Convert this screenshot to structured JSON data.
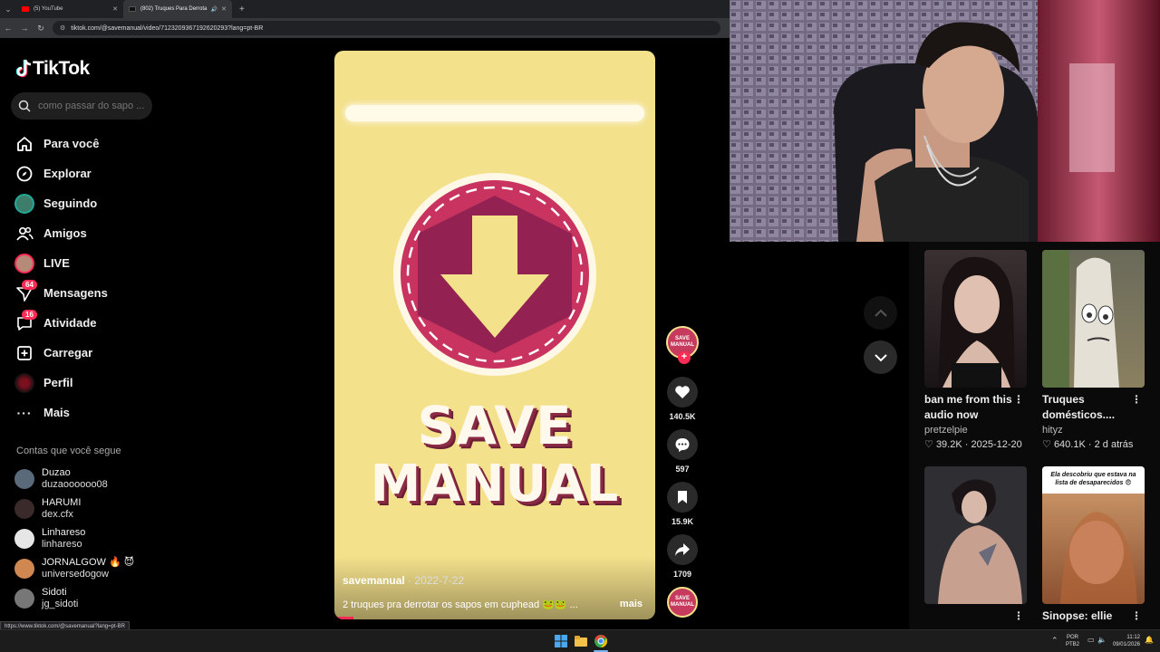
{
  "browser": {
    "tabs": [
      {
        "title": "(5) YouTube",
        "active": false
      },
      {
        "title": "(802) Truques Para Derrota",
        "active": true
      }
    ],
    "url": "tiktok.com/@savemanual/video/7123209367192620293?lang=pt-BR",
    "status_url": "https://www.tiktok.com/@savemanual?lang=pt-BR"
  },
  "sidebar": {
    "logo": "TikTok",
    "search_placeholder": "como passar do sapo ...",
    "nav": [
      {
        "label": "Para você",
        "icon": "home-icon"
      },
      {
        "label": "Explorar",
        "icon": "compass-icon"
      },
      {
        "label": "Seguindo",
        "icon": "following-avatar"
      },
      {
        "label": "Amigos",
        "icon": "friends-icon"
      },
      {
        "label": "LIVE",
        "icon": "live-avatar"
      },
      {
        "label": "Mensagens",
        "icon": "messages-icon",
        "badge": "64"
      },
      {
        "label": "Atividade",
        "icon": "activity-icon",
        "badge": "16"
      },
      {
        "label": "Carregar",
        "icon": "upload-icon"
      },
      {
        "label": "Perfil",
        "icon": "profile-avatar"
      },
      {
        "label": "Mais",
        "icon": "more-icon"
      }
    ],
    "following_title": "Contas que você segue",
    "following": [
      {
        "name": "Duzao",
        "handle": "duzaoooooo08",
        "color": "#5a6a7a"
      },
      {
        "name": "HARUMI",
        "handle": "dex.cfx",
        "color": "#3a2a2a"
      },
      {
        "name": "Linhareso",
        "handle": "linhareso",
        "color": "#e6e6e6"
      },
      {
        "name": "JORNALGOW 🔥 😈",
        "handle": "universedogow",
        "color": "#d08850"
      },
      {
        "name": "Sidoti",
        "handle": "jg_sidoti",
        "color": "#777"
      }
    ]
  },
  "video": {
    "author": "savemanual",
    "date": "· 2022-7-22",
    "caption": "2 truques pra derrotar os sapos em cuphead 🐸🐸 ...",
    "more": "mais",
    "line1": "SAVE",
    "line2": "MANUAL",
    "avatar_text": "SAVE MANUAL",
    "progress": 0.06
  },
  "actions": {
    "likes": "140.5K",
    "comments": "597",
    "saves": "15.9K",
    "shares": "1709"
  },
  "recommendations": [
    {
      "title": "ban me from this audio now",
      "user": "pretzelpie",
      "likes": "39.2K",
      "date": "2025-12-20"
    },
    {
      "title": "Truques domésticos....",
      "user": "hityz",
      "likes": "640.1K",
      "date": "2 d atrás"
    },
    {
      "title": "",
      "overlay": ""
    },
    {
      "title": "Sinopse: ellie",
      "overlay": "Ela descobriu que estava na lista de desaparecidos 😨"
    }
  ],
  "taskbar": {
    "lang": "POR",
    "layout": "PTB2",
    "time": "11:12",
    "date": "09/01/2026"
  },
  "colors": {
    "accent": "#fe2c55",
    "video_bg": "#f4e18c",
    "circle": "#8a2a55"
  }
}
